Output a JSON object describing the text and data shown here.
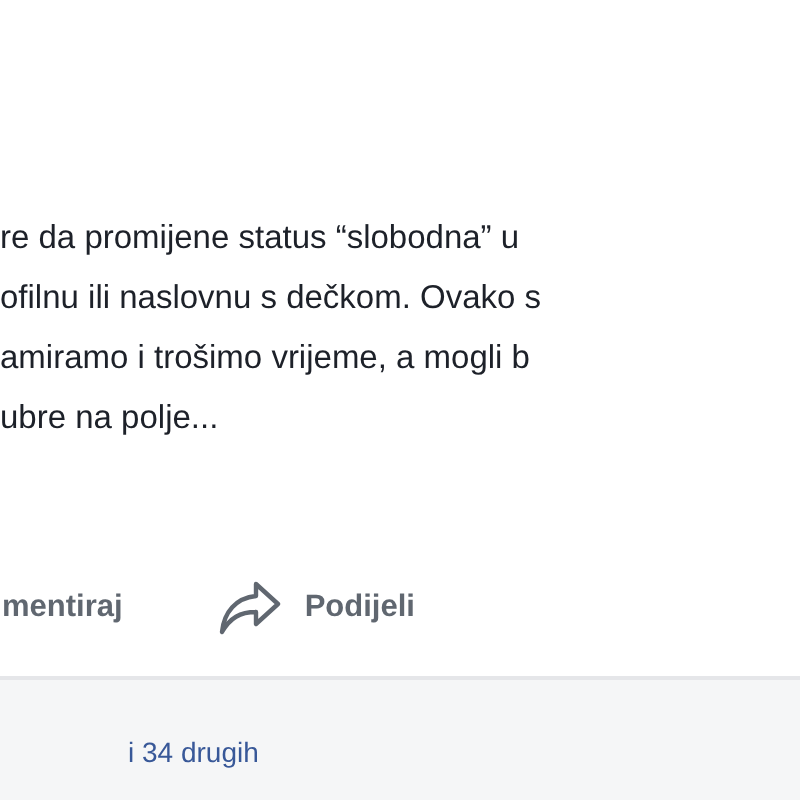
{
  "post": {
    "text_lines": [
      "re da promijene status “slobodna” u",
      "ofilnu ili naslovnu s dečkom. Ovako s",
      "amiramo i trošimo vrijeme, a mogli b",
      "ubre na polje..."
    ]
  },
  "actions": [
    {
      "kind": "comment",
      "label": "mentiraj"
    },
    {
      "kind": "share",
      "label": "Podijeli"
    }
  ],
  "reactions": {
    "summary": "i 34 drugih"
  }
}
